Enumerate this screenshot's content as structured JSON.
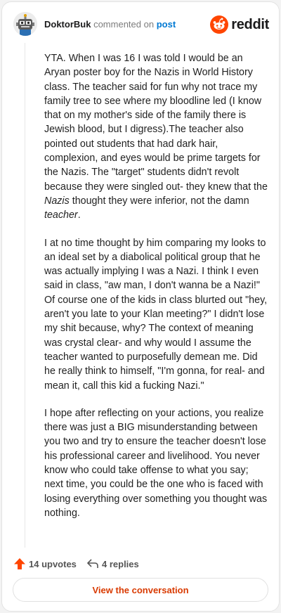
{
  "header": {
    "author": "DoktorBuk",
    "action_text": "commented on",
    "post_link": "post",
    "brand": "reddit"
  },
  "comment": {
    "p1_a": "YTA. When I was 16 I was told I would be an Aryan poster boy for the Nazis in World History class. The teacher said for fun why not trace my family tree to see where my bloodline led (I know that on my mother's side of the family there is Jewish blood, but I digress).The teacher also pointed out students that had dark hair, complexion, and eyes would be prime targets for the Nazis. The \"target\" students didn't revolt because they were singled out- they knew that the ",
    "p1_em1": "Nazis",
    "p1_b": " thought they were inferior, not the damn ",
    "p1_em2": "teacher",
    "p1_c": ".",
    "p2": "I at no time thought by him comparing my looks to an ideal set by a diabolical political group that he was actually implying I was a Nazi. I think I even said in class, \"aw man, I don't wanna be a Nazi!\" Of course one of the kids in class blurted out \"hey, aren't you late to your Klan meeting?\" I didn't lose my shit because, why? The context of meaning was crystal clear- and why would I assume the teacher wanted to purposefully demean me. Did he really think to himself, \"I'm gonna, for real- and mean it, call this kid a fucking Nazi.\"",
    "p3": "I hope after reflecting on your actions, you realize there was just a BIG misunderstanding between you two and try to ensure the teacher doesn't lose his professional career and livelihood. You never know who could take offense to what you say; next time, you could be the one who is faced with losing everything over something you thought was nothing."
  },
  "footer": {
    "upvotes": "14 upvotes",
    "replies": "4 replies"
  },
  "cta": {
    "label": "View the conversation"
  },
  "colors": {
    "accent": "#ff4500",
    "link": "#0079d3",
    "cta_text": "#d93a00"
  }
}
